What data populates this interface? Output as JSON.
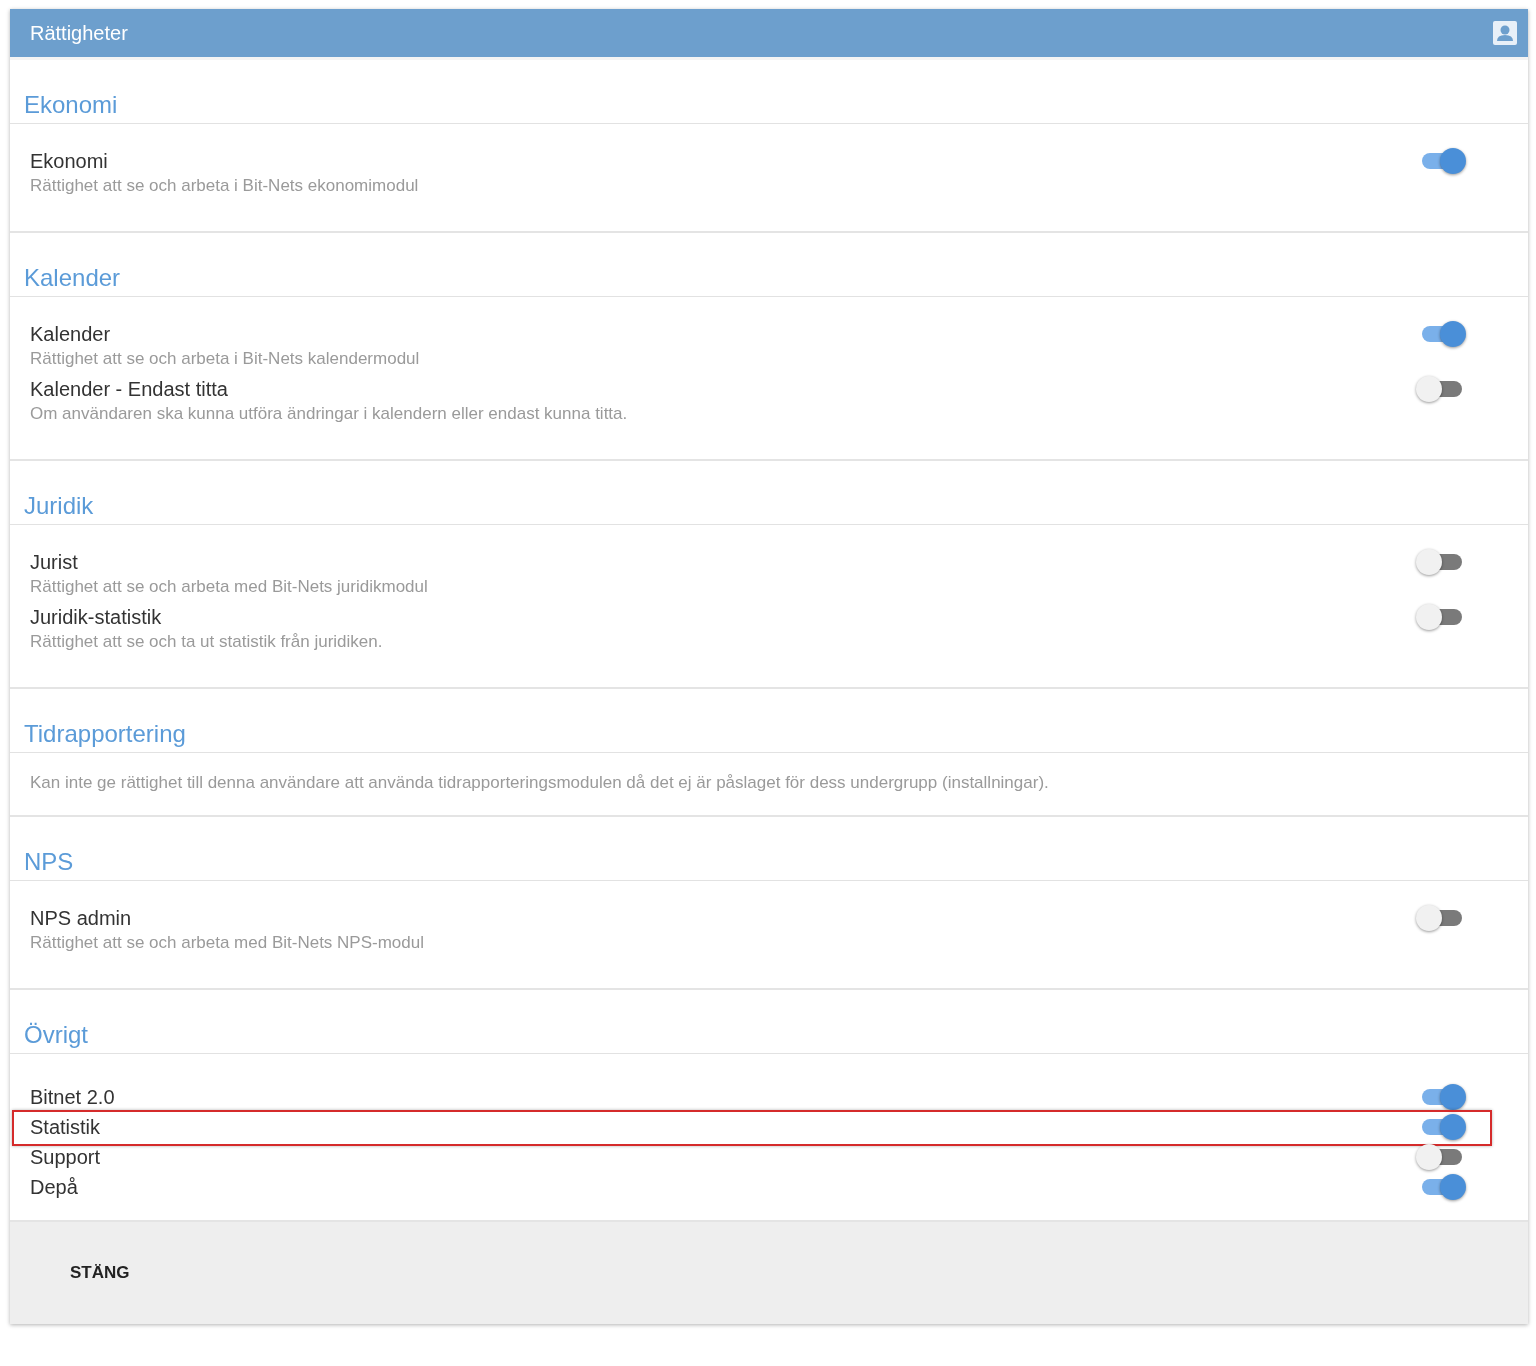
{
  "dialog": {
    "title": "Rättigheter"
  },
  "sections": [
    {
      "title": "Ekonomi",
      "items": [
        {
          "label": "Ekonomi",
          "description": "Rättighet att se och arbeta i Bit-Nets ekonomimodul",
          "on": true,
          "highlighted": false
        }
      ]
    },
    {
      "title": "Kalender",
      "items": [
        {
          "label": "Kalender",
          "description": "Rättighet att se och arbeta i Bit-Nets kalendermodul",
          "on": true,
          "highlighted": false
        },
        {
          "label": "Kalender - Endast titta",
          "description": "Om användaren ska kunna utföra ändringar i kalendern eller endast kunna titta.",
          "on": false,
          "highlighted": false
        }
      ]
    },
    {
      "title": "Juridik",
      "items": [
        {
          "label": "Jurist",
          "description": "Rättighet att se och arbeta med Bit-Nets juridikmodul",
          "on": false,
          "highlighted": false
        },
        {
          "label": "Juridik-statistik",
          "description": "Rättighet att se och ta ut statistik från juridiken.",
          "on": false,
          "highlighted": false
        }
      ]
    },
    {
      "title": "Tidrapportering",
      "note": "Kan inte ge rättighet till denna användare att använda tidrapporteringsmodulen då det ej är påslaget för dess undergrupp (installningar)."
    },
    {
      "title": "NPS",
      "items": [
        {
          "label": "NPS admin",
          "description": "Rättighet att se och arbeta med Bit-Nets NPS-modul",
          "on": false,
          "highlighted": false
        }
      ]
    },
    {
      "title": "Övrigt",
      "items": [
        {
          "label": "Bitnet 2.0",
          "on": true,
          "highlighted": false
        },
        {
          "label": "Statistik",
          "on": true,
          "highlighted": true
        },
        {
          "label": "Support",
          "on": false,
          "highlighted": false
        },
        {
          "label": "Depå",
          "on": true,
          "highlighted": false
        }
      ]
    }
  ],
  "footer": {
    "close_button": "STÄNG"
  }
}
